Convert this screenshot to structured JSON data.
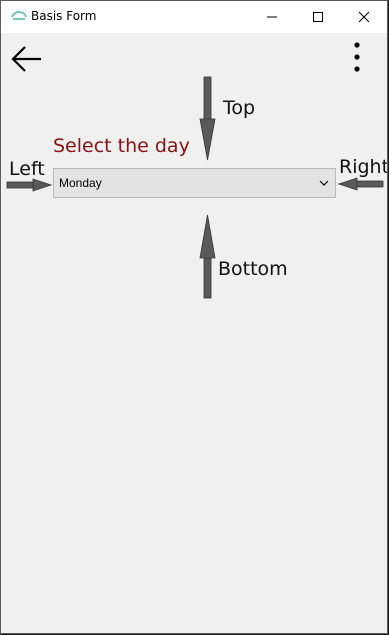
{
  "window": {
    "title": "Basis Form"
  },
  "form": {
    "label": "Select the day",
    "picker_value": "Monday"
  },
  "annotations": {
    "top": "Top",
    "bottom": "Bottom",
    "left": "Left",
    "right": "Right"
  },
  "colors": {
    "label": "#8b1010",
    "arrow": "#5a5a5a",
    "picker_bg": "#e3e3e3"
  },
  "icons": [
    "app-icon",
    "minimize-icon",
    "maximize-icon",
    "close-icon",
    "back-arrow-icon",
    "more-vertical-icon",
    "chevron-down-icon"
  ]
}
